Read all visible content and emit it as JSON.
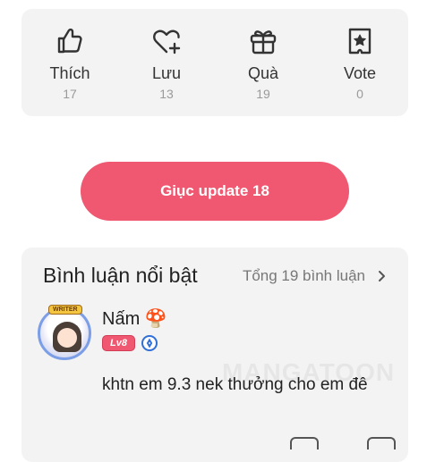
{
  "actions": [
    {
      "icon": "thumbs-up-icon",
      "label": "Thích",
      "count": "17"
    },
    {
      "icon": "heart-plus-icon",
      "label": "Lưu",
      "count": "13"
    },
    {
      "icon": "gift-icon",
      "label": "Quà",
      "count": "19"
    },
    {
      "icon": "vote-ticket-icon",
      "label": "Vote",
      "count": "0"
    }
  ],
  "update_button": {
    "label": "Giục update 18"
  },
  "comments": {
    "title": "Bình luận nổi bật",
    "total": "Tổng 19 bình luận",
    "watermark": "MANGATOON",
    "items": [
      {
        "user_name": "Nấm 🍄",
        "avatar_badge": "WRITER",
        "level": "Lv8",
        "text": "khtn em 9.3 nek thưởng cho em đê"
      }
    ]
  },
  "colors": {
    "accent": "#ef5870",
    "card_bg": "#f3f3f3",
    "muted": "#9a9a9a"
  }
}
